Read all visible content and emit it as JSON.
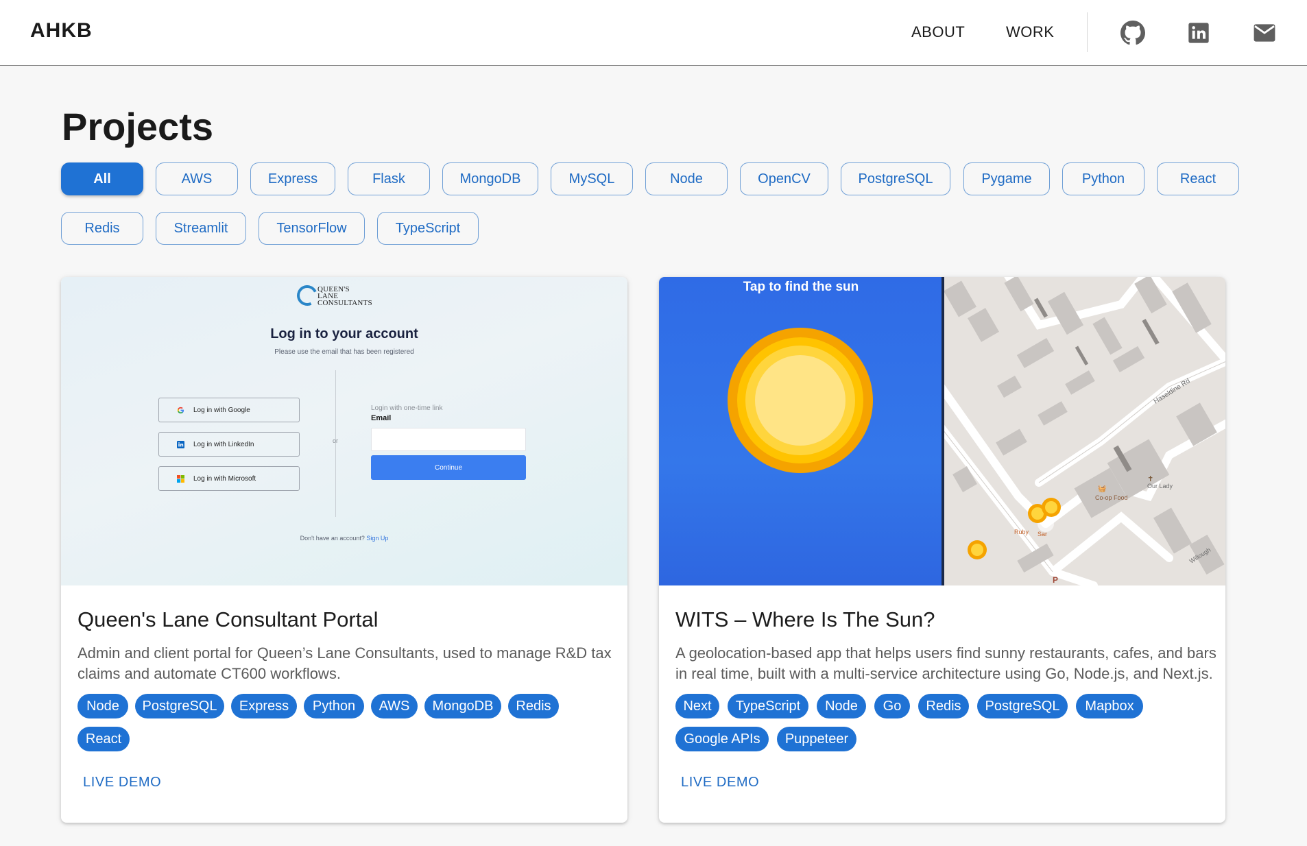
{
  "header": {
    "brand": "AHKB",
    "nav": [
      "ABOUT",
      "WORK"
    ],
    "icons": [
      "github-icon",
      "linkedin-icon",
      "mail-icon"
    ]
  },
  "main": {
    "title": "Projects",
    "filters": [
      "All",
      "AWS",
      "Express",
      "Flask",
      "MongoDB",
      "MySQL",
      "Node",
      "OpenCV",
      "PostgreSQL",
      "Pygame",
      "Python",
      "React",
      "Redis",
      "Streamlit",
      "TensorFlow",
      "TypeScript"
    ],
    "active_filter": "All"
  },
  "projects": [
    {
      "title": "Queen's Lane Consultant Portal",
      "description": "Admin and client portal for Queen’s Lane Consultants, used to manage R&D tax claims and automate CT600 workflows.",
      "tags": [
        "Node",
        "PostgreSQL",
        "Express",
        "Python",
        "AWS",
        "MongoDB",
        "Redis",
        "React"
      ],
      "action": "LIVE DEMO",
      "preview": {
        "logo_text": "QUEEN'S\nLANE\nCONSULTANTS",
        "heading": "Log in to your account",
        "subheading": "Please use the email that has been registered",
        "sso_buttons": [
          "Log in with Google",
          "Log in with LinkedIn",
          "Log in with Microsoft"
        ],
        "divider": "or",
        "otl_label": "Login with one-time link",
        "email_label": "Email",
        "continue": "Continue",
        "footer_prefix": "Don't have an account?",
        "footer_link": "Sign Up"
      }
    },
    {
      "title": "WITS – Where Is The Sun?",
      "description": "A geolocation-based app that helps users find sunny restaurants, cafes, and bars in real time, built with a multi-service architecture using Go, Node.js, and Next.js.",
      "tags": [
        "Next",
        "TypeScript",
        "Node",
        "Go",
        "Redis",
        "PostgreSQL",
        "Mapbox",
        "Google APIs",
        "Puppeteer"
      ],
      "action": "LIVE DEMO",
      "preview": {
        "caption": "Tap to find the sun",
        "map_labels": [
          "Haseldine Rd",
          "Co-op Food",
          "Our Lady",
          "Ruby",
          "Sar",
          "Willough"
        ]
      }
    }
  ],
  "colors": {
    "accent": "#1f72d4",
    "background": "#f7f7f7"
  }
}
